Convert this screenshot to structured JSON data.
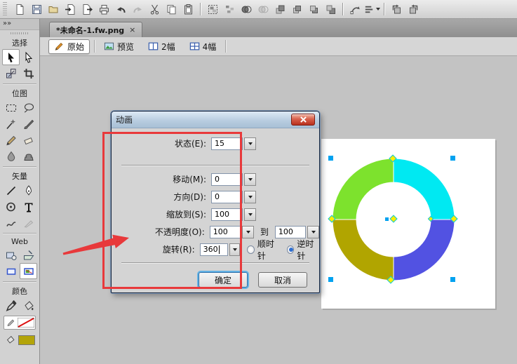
{
  "toolbar": {
    "icons": [
      "new-document",
      "save",
      "open",
      "import",
      "export",
      "print",
      "undo",
      "redo",
      "cut",
      "copy",
      "paste",
      "group",
      "ungroup",
      "combine-shapes",
      "split-shapes",
      "bring-to-front",
      "bring-forward",
      "send-backward",
      "send-to-back",
      "free-transform",
      "align",
      "rotate-90-ccw",
      "rotate-90-cw"
    ]
  },
  "document_tab": {
    "title": "*未命名-1.fw.png",
    "close": "×"
  },
  "view_modes": {
    "original": "原始",
    "preview": "预览",
    "two_up": "2幅",
    "four_up": "4幅"
  },
  "sidebar": {
    "sections": {
      "select": "选择",
      "bitmap": "位图",
      "vector": "矢量",
      "web": "Web",
      "colors": "颜色"
    },
    "tools": [
      "pointer",
      "subselection",
      "scale",
      "crop",
      "marquee",
      "lasso",
      "magic-wand",
      "brush",
      "pencil",
      "eraser",
      "blur",
      "rubber-stamp",
      "line",
      "pen",
      "ellipse",
      "text",
      "freeform",
      "knife",
      "hotspot",
      "slice",
      "hide-slices",
      "show-slices",
      "eyedropper",
      "paint-bucket"
    ],
    "stroke_color": "none-red-slash",
    "fill_color": "#b3a409"
  },
  "dialog": {
    "title": "动画",
    "rows": [
      {
        "label": "状态(E):",
        "value": "15"
      },
      {
        "label": "移动(M):",
        "value": "0"
      },
      {
        "label": "方向(D):",
        "value": "0"
      },
      {
        "label": "缩放到(S):",
        "value": "100"
      },
      {
        "label": "不透明度(O):",
        "value": "100",
        "to": "到",
        "value2": "100"
      },
      {
        "label": "旋转(R):",
        "value": "360",
        "radio_cw": "顺时针",
        "radio_ccw": "逆时针",
        "selected": "逆时针"
      }
    ],
    "buttons": {
      "ok": "确定",
      "cancel": "取消"
    }
  },
  "canvas_object": {
    "type": "donut-ring",
    "segments": [
      {
        "position": "top-right",
        "color": "#00e9f2"
      },
      {
        "position": "bottom-right",
        "color": "#5252e2"
      },
      {
        "position": "bottom-left",
        "color": "#b1a500"
      },
      {
        "position": "top-left",
        "color": "#7de22d"
      }
    ],
    "handles": {
      "corner_color": "#00a2f0",
      "point_fill": "#ffee00",
      "point_border": "#00c8ea"
    }
  },
  "annotation": {
    "color": "#e8393b"
  }
}
